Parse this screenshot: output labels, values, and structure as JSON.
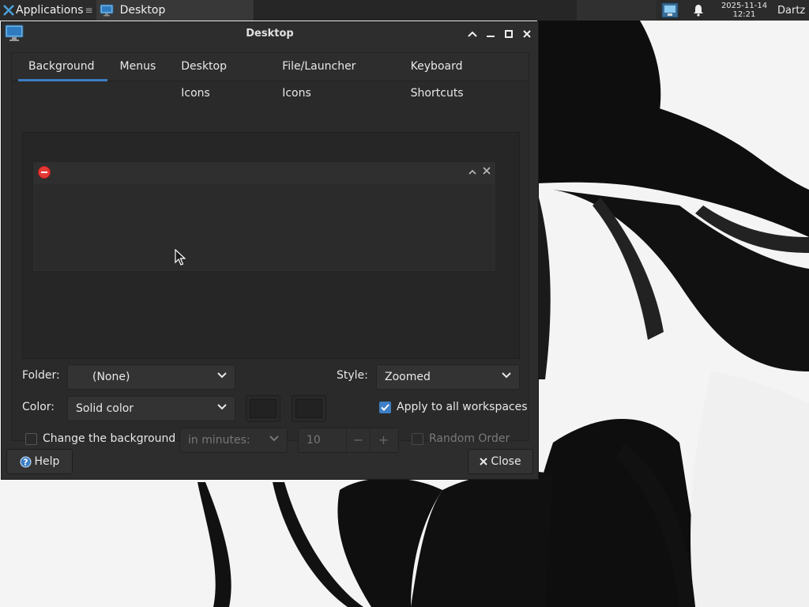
{
  "panel": {
    "applications_label": "Applications",
    "applications_sep": "≡",
    "task_label": "Desktop",
    "clock_date": "2025-11-14",
    "clock_time": "12:21",
    "user": "Dartz"
  },
  "window": {
    "title": "Desktop",
    "controls": {
      "shade": "˄",
      "minimize": "—",
      "maximize": "□",
      "close": "✕"
    }
  },
  "tabs": [
    {
      "label": "Background",
      "active": true
    },
    {
      "label": "Menus",
      "active": false
    },
    {
      "label": "Desktop Icons",
      "active": false
    },
    {
      "label": "File/Launcher Icons",
      "active": false
    },
    {
      "label": "Keyboard Shortcuts",
      "active": false
    }
  ],
  "form": {
    "folder_label": "Folder:",
    "folder_value": "(None)",
    "style_label": "Style:",
    "style_value": "Zoomed",
    "color_label": "Color:",
    "color_value": "Solid color",
    "apply_all_label": "Apply to all workspaces",
    "apply_all_checked": true,
    "change_bg_label": "Change the background",
    "change_bg_checked": false,
    "interval_unit": "in minutes:",
    "interval_value": "10",
    "spin_minus": "−",
    "spin_plus": "+",
    "random_order_label": "Random Order",
    "random_order_checked": false
  },
  "buttons": {
    "help_label": "Help",
    "close_label": "Close"
  },
  "colors": {
    "accent": "#3d7ec4",
    "window_bg": "#2d2d2d",
    "error_icon": "#e53935"
  }
}
